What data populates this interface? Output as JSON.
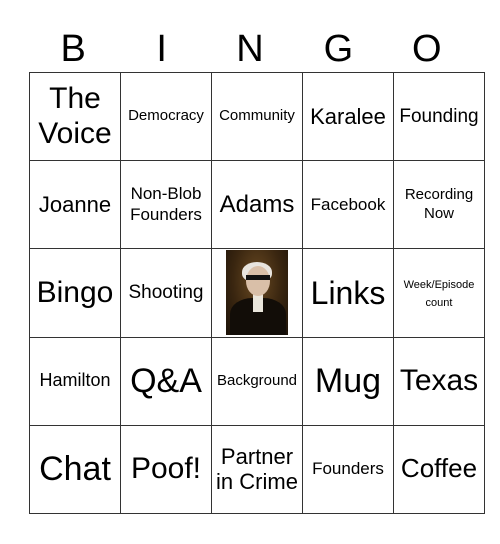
{
  "header": [
    "B",
    "I",
    "N",
    "G",
    "O"
  ],
  "rows": [
    [
      {
        "text": "The Voice",
        "size": "s30"
      },
      {
        "text": "Democracy",
        "size": "s15"
      },
      {
        "text": "Community",
        "size": "s15"
      },
      {
        "text": "Karalee",
        "size": "s22"
      },
      {
        "text": "Founding",
        "size": "s19"
      }
    ],
    [
      {
        "text": "Joanne",
        "size": "s22"
      },
      {
        "text": "Non-Blob Founders",
        "size": "s17"
      },
      {
        "text": "Adams",
        "size": "s24"
      },
      {
        "text": "Facebook",
        "size": "s17"
      },
      {
        "text": "Recording Now",
        "size": "s15"
      }
    ],
    [
      {
        "text": "Bingo",
        "size": "s30"
      },
      {
        "text": "Shooting",
        "size": "s19"
      },
      {
        "text": "",
        "size": "",
        "image": "george-washington-portrait"
      },
      {
        "text": "Links",
        "size": "s32"
      },
      {
        "text": "Week/Episode count",
        "size": "s11"
      }
    ],
    [
      {
        "text": "Hamilton",
        "size": "s18"
      },
      {
        "text": "Q&A",
        "size": "s34"
      },
      {
        "text": "Background",
        "size": "s15"
      },
      {
        "text": "Mug",
        "size": "s34"
      },
      {
        "text": "Texas",
        "size": "s30"
      }
    ],
    [
      {
        "text": "Chat",
        "size": "s34"
      },
      {
        "text": "Poof!",
        "size": "s30"
      },
      {
        "text": "Partner in Crime",
        "size": "s22"
      },
      {
        "text": "Founders",
        "size": "s17"
      },
      {
        "text": "Coffee",
        "size": "s26"
      }
    ]
  ]
}
